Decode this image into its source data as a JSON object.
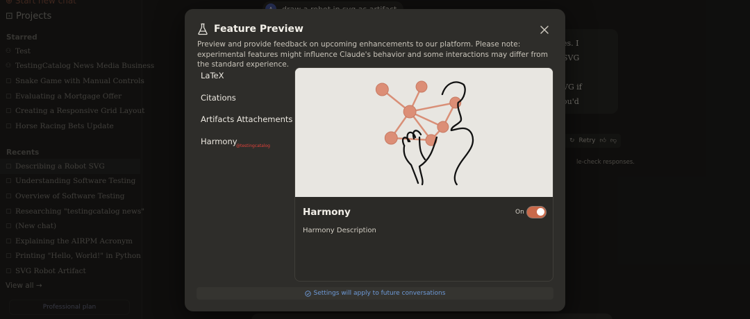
{
  "sidebar": {
    "start_chat": "Start new chat",
    "projects": "Projects",
    "starred_heading": "Starred",
    "starred": [
      "Test",
      "TestingCatalog News Media Business",
      "Snake Game with Manual Controls",
      "Evaluating a Mortgage Offer",
      "Creating a Responsive Grid Layout",
      "Horse Racing Bets Update"
    ],
    "recents_heading": "Recents",
    "recents": [
      "Describing a Robot SVG",
      "Understanding Software Testing",
      "Overview of Software Testing",
      "Researching \"testingcatalog news\"",
      "(New chat)",
      "Explaining the AIRPM Acronym",
      "Printing \"Hello, World!\" in Python",
      "SVG Robot Artifact"
    ],
    "view_all": "View all →",
    "plan": "Professional plan"
  },
  "chat": {
    "prompt_chip": "draw a robot in svg as artifact",
    "avatar_letter": "A",
    "message_lines": [
      "es. I",
      "SVG",
      "",
      "VG if",
      "ou'd",
      "e"
    ],
    "retry": "Retry",
    "disclaimer": "le-check responses."
  },
  "modal": {
    "title": "Feature Preview",
    "description": "Preview and provide feedback on upcoming enhancements to our platform. Please note: experimental features might influence Claude's behavior and some interactions may differ from the standard experience.",
    "features": [
      "LaTeX",
      "Citations",
      "Artifacts Attachements",
      "Harmony"
    ],
    "selected_index": 3,
    "watermark": "@testingcatalog",
    "detail": {
      "name": "Harmony",
      "toggle_label": "On",
      "enabled": true,
      "description": "Harmony Description"
    },
    "footer": "Settings will apply to future conversations"
  },
  "colors": {
    "accent": "#c9694a",
    "link": "#6e9ad8",
    "modal_bg": "#2e2d2a",
    "illustration_bg": "#e8e6e1",
    "node": "#dc8e76"
  },
  "icons": {
    "title": "flask-icon",
    "close": "close-icon",
    "footer": "check-circle-icon"
  }
}
